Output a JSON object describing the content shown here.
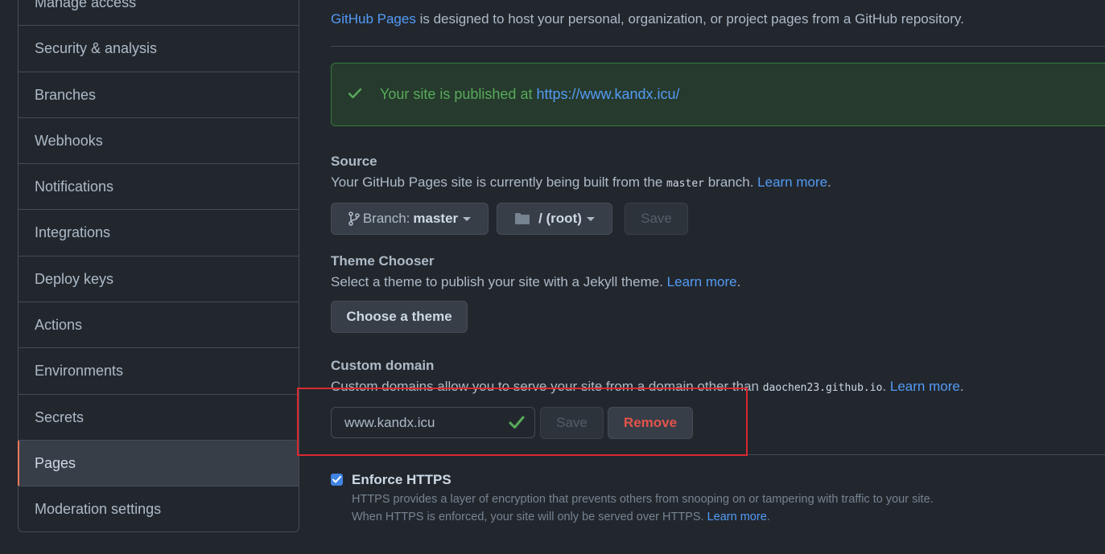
{
  "sidebar": {
    "items": [
      {
        "label": "Manage access"
      },
      {
        "label": "Security & analysis"
      },
      {
        "label": "Branches"
      },
      {
        "label": "Webhooks"
      },
      {
        "label": "Notifications"
      },
      {
        "label": "Integrations"
      },
      {
        "label": "Deploy keys"
      },
      {
        "label": "Actions"
      },
      {
        "label": "Environments"
      },
      {
        "label": "Secrets"
      },
      {
        "label": "Pages",
        "active": true
      },
      {
        "label": "Moderation settings"
      }
    ]
  },
  "intro": {
    "link": "GitHub Pages",
    "text": " is designed to host your personal, organization, or project pages from a GitHub repository."
  },
  "flash": {
    "text": "Your site is published at ",
    "url": "https://www.kandx.icu/"
  },
  "source": {
    "title": "Source",
    "desc_prefix": "Your GitHub Pages site is currently being built from the ",
    "branch_code": "master",
    "desc_suffix": " branch. ",
    "learn_more": "Learn more",
    "period": ".",
    "branch_label": "Branch:",
    "branch_value": "master",
    "folder_value": "/ (root)",
    "save_label": "Save"
  },
  "theme": {
    "title": "Theme Chooser",
    "desc": "Select a theme to publish your site with a Jekyll theme. ",
    "learn_more": "Learn more",
    "period": ".",
    "button": "Choose a theme"
  },
  "custom_domain": {
    "title": "Custom domain",
    "desc": "Custom domains allow you to serve your site from a domain other than ",
    "domain_code": "daochen23.github.io",
    "desc_suffix": ". ",
    "learn_more": "Learn more",
    "period": ".",
    "input_value": "www.kandx.icu",
    "save_label": "Save",
    "remove_label": "Remove"
  },
  "https": {
    "title": "Enforce HTTPS",
    "checked": true,
    "line1": "HTTPS provides a layer of encryption that prevents others from snooping on or tampering with traffic to your site.",
    "line2": "When HTTPS is enforced, your site will only be served over HTTPS. ",
    "learn_more": "Learn more",
    "period": "."
  },
  "colors": {
    "accent": "#539bf5",
    "success": "#57ab5a",
    "danger": "#e5534b",
    "highlight": "#d9292f",
    "background": "#22272e"
  },
  "icons": [
    "check-icon",
    "git-branch-icon",
    "folder-icon",
    "caret-down-icon",
    "checkbox-checked-icon"
  ]
}
